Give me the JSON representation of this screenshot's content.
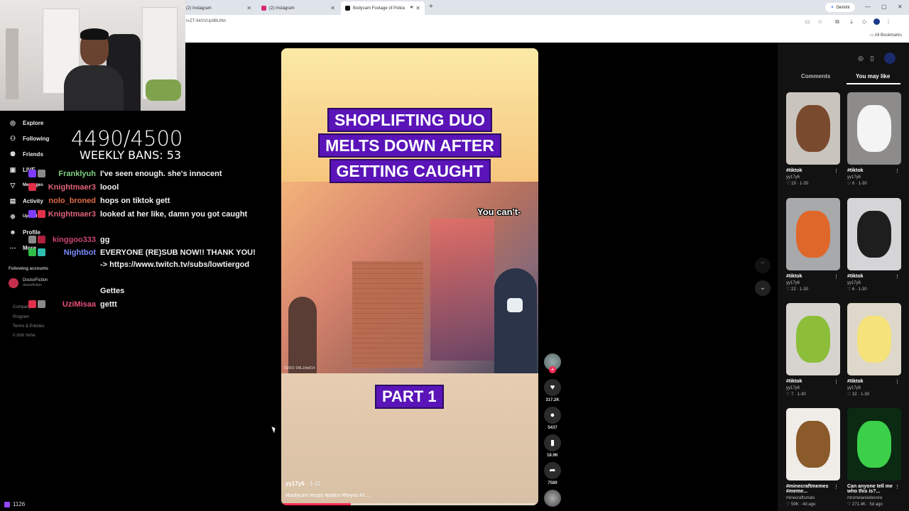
{
  "browser": {
    "tabs": [
      {
        "label": "(2) Instagram",
        "active": false
      },
      {
        "label": "(2) Instagram",
        "active": false
      },
      {
        "label": "Bodycam Footage of Police",
        "active": true
      }
    ],
    "new_tab": "+",
    "gemini_label": "Gemini",
    "url": "t=ZT-94SVUp9BUNh",
    "all_bookmarks": "All Bookmarks"
  },
  "tiktok_nav": {
    "items": [
      {
        "label": "Explore",
        "icon": "compass-icon"
      },
      {
        "label": "Following",
        "icon": "following-icon"
      },
      {
        "label": "Friends",
        "icon": "friends-icon"
      },
      {
        "label": "LIVE",
        "icon": "live-icon"
      },
      {
        "label": "Messages",
        "icon": "messages-icon"
      },
      {
        "label": "Activity",
        "icon": "activity-icon"
      },
      {
        "label": "Upload",
        "icon": "upload-icon"
      },
      {
        "label": "Profile",
        "icon": "profile-icon"
      },
      {
        "label": "More",
        "icon": "more-icon"
      }
    ],
    "following_accounts_label": "Following accounts",
    "account": {
      "name": "DoctorFiction",
      "handle": "doctorfiction"
    },
    "footer": [
      "Company",
      "Program",
      "Terms & Policies"
    ],
    "copyright": "© 2026 TikTok"
  },
  "stream_overlay": {
    "ban_count": "4490/4500",
    "weekly_bans": "WEEKLY BANS: 53",
    "viewers": "1126"
  },
  "chat": [
    {
      "user": "Franklyuh",
      "color": "#7fd17f",
      "message": "I've seen enough. she's innocent"
    },
    {
      "user": "Knightmaer3",
      "color": "#e0637a",
      "message": "loool"
    },
    {
      "user": "nolo_broned",
      "color": "#e06b4a",
      "message": "hops on tiktok gett"
    },
    {
      "user": "Knightmaer3",
      "color": "#e0637a",
      "message": "looked at her like, damn you got caught"
    },
    {
      "user": "kinggoo333",
      "color": "#c94474",
      "message": "gg"
    },
    {
      "user": "Nightbot",
      "color": "#7d8cff",
      "message": "EVERYONE (RE)SUB NOW!! THANK YOU! -> https://www.twitch.tv/subs/lowtiergod"
    },
    {
      "user": "",
      "color": "#ffffff",
      "message": "Gettes"
    },
    {
      "user": "UziMisaa",
      "color": "#e8507a",
      "message": "gettt"
    }
  ],
  "video": {
    "title_lines": [
      "SHOPLIFTING DUO",
      "MELTS DOWN AFTER",
      "GETTING CAUGHT"
    ],
    "subtitle": "You can't-",
    "part_label": "PART 1",
    "watermark": "©2001 SNLJ/de014",
    "author": "yy17y6",
    "date": "· 1-11",
    "caption": "#bodycam #cops #police #foryou #1 ...",
    "progress": 0.27
  },
  "actions": {
    "likes": "317.2K",
    "comments": "5437",
    "saves": "18.9K",
    "shares": "7589"
  },
  "right_panel": {
    "tabs": [
      "Comments",
      "You may like"
    ],
    "active_tab": "You may like",
    "cards": [
      {
        "tag": "#tiktok",
        "author": "yy17y6",
        "stats": "♡ 19 · 1-30",
        "colors": [
          "#c9c4bd",
          "#7a4a2e"
        ]
      },
      {
        "tag": "#tiktok",
        "author": "yy17y6",
        "stats": "♡ 6 · 1-30",
        "colors": [
          "#8d8c8a",
          "#f4f4f4"
        ]
      },
      {
        "tag": "#tiktok",
        "author": "yy17y6",
        "stats": "♡ 22 · 1-30",
        "colors": [
          "#a8a9ab",
          "#e0672a"
        ]
      },
      {
        "tag": "#tiktok",
        "author": "yy17y6",
        "stats": "♡ 6 · 1-30",
        "colors": [
          "#d5d5d7",
          "#1e1e1e"
        ]
      },
      {
        "tag": "#tiktok",
        "author": "yy17y6",
        "stats": "♡ 7 · 1-30",
        "colors": [
          "#d7d4d0",
          "#8cbe3a"
        ]
      },
      {
        "tag": "#tiktok",
        "author": "yy17y6",
        "stats": "♡ 32 · 1-30",
        "colors": [
          "#ddd8c9",
          "#f5e27a"
        ]
      },
      {
        "tag": "#minecraftmemes #meme...",
        "author": "minecraftsmals",
        "stats": "♡ 59K · 4d ago",
        "colors": [
          "#f0ece8",
          "#8a5a2a"
        ]
      },
      {
        "tag": "Can anyone tell me who this is?...",
        "author": "mrsmelaniedevore",
        "stats": "♡ 271.4K · 5d ago",
        "colors": [
          "#0a2a12",
          "#3cd04a"
        ]
      }
    ]
  }
}
